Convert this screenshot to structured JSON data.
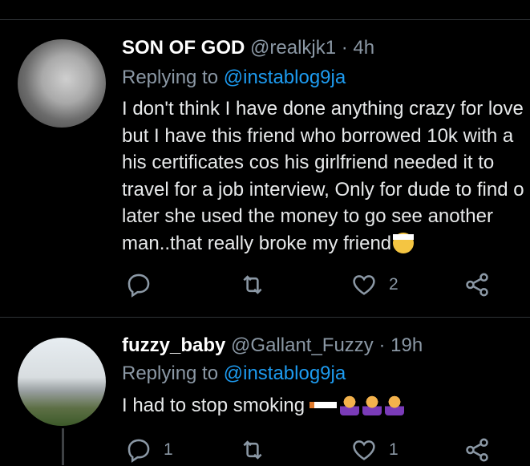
{
  "tweets": [
    {
      "display_name": "SON OF GOD",
      "handle": "@realkjk1",
      "dot": "·",
      "time": "4h",
      "replying_prefix": "Replying to",
      "replying_to": "@instablog9ja",
      "text_lines": [
        "I don't think I have done anything crazy for love",
        "but I have this friend who borrowed 10k with a",
        "his certificates cos his girlfriend needed it to",
        "travel for a job interview, Only for dude to find o",
        "later she used the money to go see another",
        "man..that really broke my friend"
      ],
      "text_emoji": "face-with-head-bandage",
      "reply_count": "",
      "retweet_count": "",
      "like_count": "2"
    },
    {
      "display_name": "fuzzy_baby",
      "handle": "@Gallant_Fuzzy",
      "dot": "·",
      "time": "19h",
      "replying_prefix": "Replying to",
      "replying_to": "@instablog9ja",
      "text_lines": [
        "I had to stop smoking"
      ],
      "text_emoji": "cigarette, woman-facepalming x3",
      "reply_count": "1",
      "retweet_count": "",
      "like_count": "1"
    }
  ],
  "icons": {
    "reply": "reply-icon",
    "retweet": "retweet-icon",
    "like": "heart-icon",
    "share": "share-icon"
  },
  "colors": {
    "background": "#000000",
    "mention": "#1d9bf0",
    "muted": "#8b98a5",
    "text": "#e7e9ea"
  }
}
